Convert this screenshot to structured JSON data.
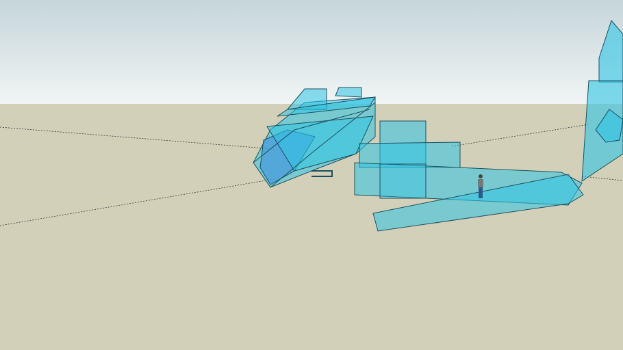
{
  "viewport": {
    "type": "3d-model-viewport",
    "colors": {
      "sky_top": "#c5d6da",
      "sky_horizon": "#f1f4f4",
      "ground": "#d3d0b9",
      "model_fill": "#2fc4e4",
      "model_fill_dark": "#3a8fe0",
      "edge": "#1b4f5e",
      "axis_line": "#333333"
    }
  }
}
